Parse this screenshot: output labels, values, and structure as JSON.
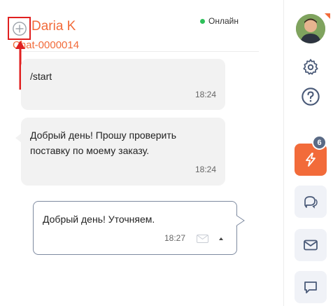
{
  "header": {
    "contact_name": "Daria K",
    "chat_id": "Chat-0000014",
    "status": "Онлайн"
  },
  "messages": [
    {
      "text": "/start",
      "time": "18:24"
    },
    {
      "text": "Добрый день! Прошу проверить поставку по моему заказу.",
      "time": "18:24"
    },
    {
      "text": "Добрый день! Уточняем.",
      "time": "18:27"
    }
  ],
  "sidebar": {
    "badge_count": "6",
    "icons": [
      "avatar",
      "gear-icon",
      "help-icon",
      "lightning-icon",
      "chats-icon",
      "mail-icon",
      "chat-icon"
    ]
  },
  "colors": {
    "accent": "#f26b3a",
    "online": "#2ec05a",
    "highlight": "#e02020"
  }
}
